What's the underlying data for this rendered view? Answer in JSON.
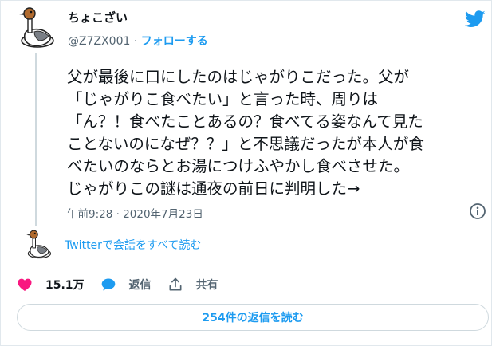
{
  "author": {
    "name": "ちょこざい",
    "handle": "@Z7ZX001",
    "separator": "·",
    "follow_label": "フォローする"
  },
  "tweet": {
    "lines": [
      "父が最後に口にしたのはじゃがりこだった。父が",
      "「じゃがりこ食べたい」と言った時、周りは",
      "「ん？！食べたことあるの？食べてる姿なんて見た",
      "ことないのになぜ？？」と不思議だったが本人が食",
      "べたいのならとお湯につけふやかし食べさせた。",
      "じゃがりこの謎は通夜の前日に判明した→"
    ],
    "timestamp": "午前9:28 · 2020年7月23日"
  },
  "conversation_link": "Twitterで会話をすべて読む",
  "actions": {
    "like_count": "15.1万",
    "reply_label": "返信",
    "share_label": "共有"
  },
  "replies_button": "254件の返信を読む",
  "colors": {
    "accent": "#1d9bf0",
    "like": "#f91880",
    "text": "#0f1419",
    "secondary": "#536471"
  },
  "icons": [
    "duck-avatar-icon",
    "twitter-bird-icon",
    "info-icon",
    "heart-icon",
    "reply-bubble-icon",
    "share-icon"
  ]
}
